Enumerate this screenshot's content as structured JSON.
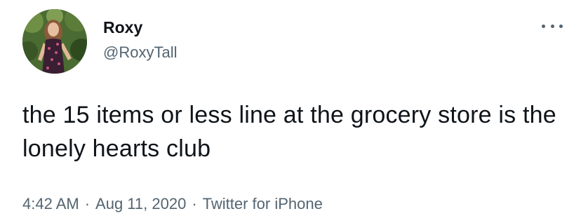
{
  "author": {
    "display_name": "Roxy",
    "handle": "@RoxyTall",
    "avatar_icon": "profile-photo"
  },
  "menu": {
    "icon": "more-horizontal-icon"
  },
  "tweet": {
    "text": "the 15 items or less line at the grocery store is the lonely hearts club"
  },
  "meta": {
    "time": "4:42 AM",
    "separator": "·",
    "date": "Aug 11, 2020",
    "source": "Twitter for iPhone"
  },
  "colors": {
    "text_primary": "#0f1419",
    "text_secondary": "#536471",
    "background": "#ffffff"
  }
}
